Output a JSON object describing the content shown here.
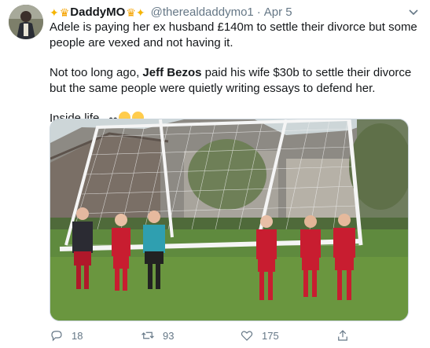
{
  "author": {
    "display_name": "DaddyMO",
    "handle": "@therealdaddymo1",
    "separator": "·",
    "date": "Apr 5"
  },
  "icons": {
    "sparkles": "sparkles-emoji",
    "crown": "crown-emoji",
    "caret": "chevron-down-icon",
    "reply": "reply-icon",
    "retweet": "retweet-icon",
    "like": "heart-icon",
    "share": "share-icon"
  },
  "tweet": {
    "line1": "Adele is paying her ex husband £140m to settle their divorce but some people are vexed and not having it.",
    "line2_prefix": "Not too long ago, ",
    "line2_bold": "Jeff Bezos",
    "line2_suffix": " paid his wife $30b to settle their divorce but the same people were quietly writing essays to defend her.",
    "line3": "Inside life.."
  },
  "actions": {
    "replies": "18",
    "retweets": "93",
    "likes": "175"
  },
  "colors": {
    "text": "#14171a",
    "secondary": "#657786",
    "border": "#ccd6dd",
    "accent_gold": "#f5b400"
  }
}
